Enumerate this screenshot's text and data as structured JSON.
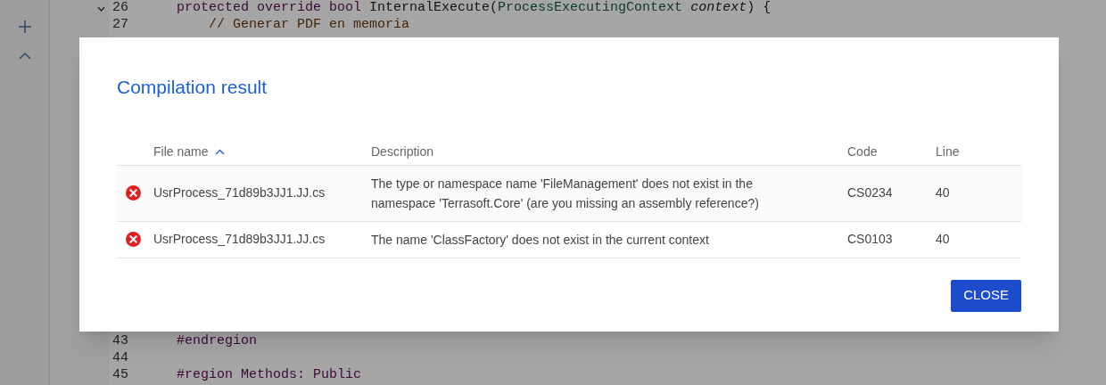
{
  "editor": {
    "top_lines": [
      {
        "number": "26",
        "fold": true,
        "tokens": [
          {
            "kind": "keyword",
            "text": "protected override bool"
          },
          {
            "kind": "plain",
            "text": " InternalExecute("
          },
          {
            "kind": "type",
            "text": "ProcessExecutingContext"
          },
          {
            "kind": "param",
            "text": " context"
          },
          {
            "kind": "plain",
            "text": ") {"
          }
        ]
      },
      {
        "number": "27",
        "fold": false,
        "tokens": [
          {
            "kind": "comment",
            "text": "    // Generar PDF en memoria"
          }
        ]
      }
    ],
    "bottom_lines": [
      {
        "number": "43",
        "fold": false,
        "tokens": [
          {
            "kind": "keyword",
            "text": "#endregion"
          }
        ]
      },
      {
        "number": "44",
        "fold": false
      },
      {
        "number": "45",
        "fold": false,
        "tokens": [
          {
            "kind": "keyword",
            "text": "#region Methods: Public"
          }
        ]
      }
    ]
  },
  "dialog": {
    "title": "Compilation result",
    "columns": [
      {
        "label": "File name",
        "sorted": true
      },
      {
        "label": "Description",
        "sorted": false
      },
      {
        "label": "Code",
        "sorted": false
      },
      {
        "label": "Line",
        "sorted": false
      }
    ],
    "rows": [
      {
        "error": true,
        "file": "UsrProcess_71d89b3JJ1.JJ.cs",
        "description": "The type or namespace name 'FileManagement' does not exist in the namespace 'Terrasoft.Core' (are you missing an assembly reference?)",
        "code": "CS0234",
        "line": "40"
      },
      {
        "error": true,
        "file": "UsrProcess_71d89b3JJ1.JJ.cs",
        "description": "The name 'ClassFactory' does not exist in the current context",
        "code": "CS0103",
        "line": "40"
      }
    ],
    "button": "CLOSE"
  }
}
